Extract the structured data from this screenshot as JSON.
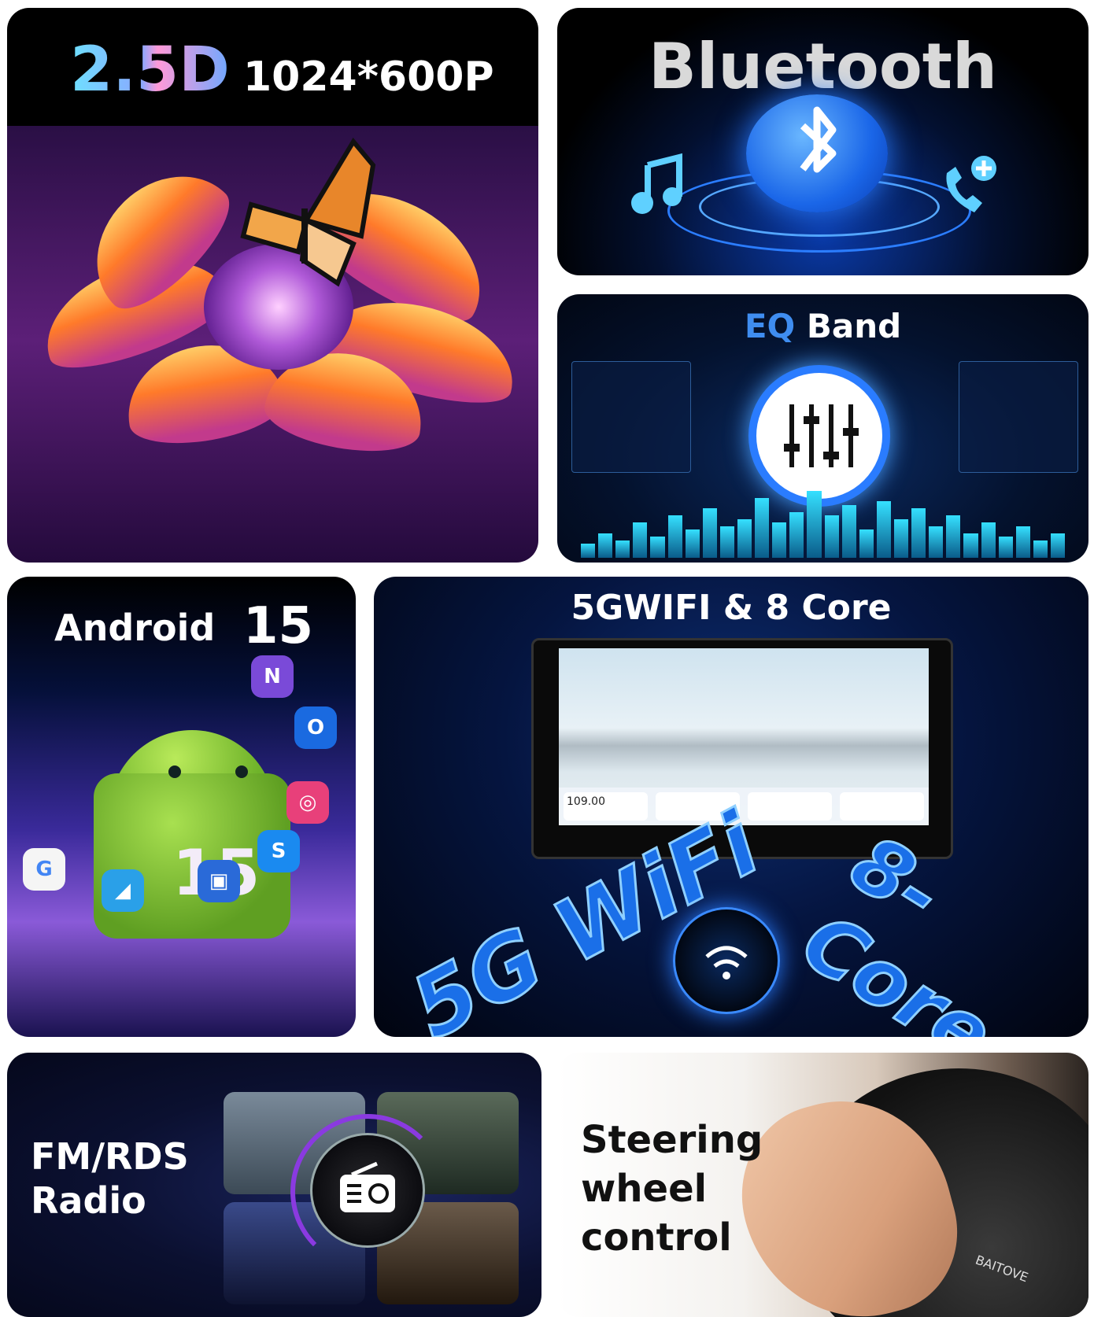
{
  "tiles": {
    "display": {
      "title_2_5d": "2.5D",
      "resolution": "1024*600P"
    },
    "bluetooth": {
      "title": "Bluetooth"
    },
    "eq": {
      "accent": "EQ",
      "rest": "Band"
    },
    "android": {
      "label": "Android",
      "version": "15",
      "badge": "15"
    },
    "wifi_core": {
      "title": "5GWIFI & 8 Core",
      "wifi_text": "5G WiFi",
      "core_text": "8-Core",
      "radio_freq": "109.00"
    },
    "radio": {
      "line1": "FM/RDS",
      "line2": "Radio"
    },
    "steering": {
      "line1": "Steering",
      "line2": "wheel",
      "line3": "control",
      "brand": "BAITOVE"
    }
  },
  "colors": {
    "accent_blue": "#3f8df0",
    "bt_blue": "#1a66e8",
    "android_green": "#6fb32a"
  },
  "icons": [
    "bluetooth-icon",
    "music-note-icon",
    "phone-add-icon",
    "equalizer-icon",
    "wifi-icon",
    "radio-icon"
  ]
}
